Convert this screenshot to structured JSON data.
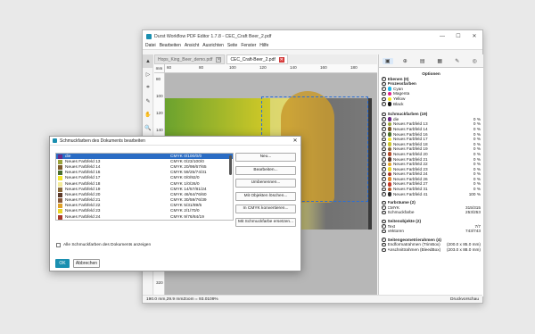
{
  "window": {
    "title": "Durst Workflow PDF Editor 1.7.8 - CEC_Craft Beer_2.pdf",
    "controls": [
      "—",
      "☐",
      "✕"
    ]
  },
  "menu": [
    "Datei",
    "Bearbeiten",
    "Ansicht",
    "Ausrichten",
    "Seite",
    "Fenster",
    "Hilfe"
  ],
  "left_tools": [
    "▲",
    "▷",
    "⌗",
    "✎",
    "✋",
    "🔍"
  ],
  "tabs": [
    {
      "label": "Hops_King_Beer_demo.pdf",
      "close": "✕"
    },
    {
      "label": "CEC_Craft-Beer_2.pdf",
      "close": "✕"
    }
  ],
  "ruler": {
    "unit": "mm",
    "h_ticks": [
      "60",
      "80",
      "100",
      "120",
      "140",
      "160",
      "180"
    ],
    "v_ticks": [
      "80",
      "100",
      "120",
      "140",
      "160",
      "180",
      "200",
      "220",
      "240",
      "260",
      "280",
      "300",
      "320"
    ]
  },
  "status": {
    "coords": "190.0 mm,29.9 mmZoom = 93.0109%",
    "right": "Druckvorschau"
  },
  "panel": {
    "icons": [
      "▣",
      "⊕",
      "▤",
      "▦",
      "✎",
      "◎"
    ],
    "optionen": "Optionen",
    "ebenen": "Ebenen (0)",
    "prozessfarben": "Prozessfarben",
    "process_colors": [
      {
        "name": "Cyan",
        "color": "#1fb6e8"
      },
      {
        "name": "Magenta",
        "color": "#e0218a"
      },
      {
        "name": "Yellow",
        "color": "#f3e61c"
      },
      {
        "name": "Black",
        "color": "#111111"
      }
    ],
    "schmuck_head": "Schmuckfarben (19)",
    "spot_colors": [
      {
        "name": "die",
        "val": "0 %",
        "color": "#6c2a86"
      },
      {
        "name": "Neues Farbfeld 13",
        "val": "0 %",
        "color": "#9aa33a"
      },
      {
        "name": "Neues Farbfeld 14",
        "val": "0 %",
        "color": "#7d5a2a"
      },
      {
        "name": "Neues Farbfeld 16",
        "val": "0 %",
        "color": "#4a6e2d"
      },
      {
        "name": "Neues Farbfeld 17",
        "val": "0 %",
        "color": "#f2e52a"
      },
      {
        "name": "Neues Farbfeld 18",
        "val": "0 %",
        "color": "#c8c22e"
      },
      {
        "name": "Neues Farbfeld 19",
        "val": "0 %",
        "color": "#8a6a3a"
      },
      {
        "name": "Neues Farbfeld 20",
        "val": "0 %",
        "color": "#b24a2a"
      },
      {
        "name": "Neues Farbfeld 21",
        "val": "0 %",
        "color": "#5c3a2a"
      },
      {
        "name": "Neues Farbfeld 22",
        "val": "0 %",
        "color": "#e0a12a"
      },
      {
        "name": "Neues Farbfeld 23",
        "val": "0 %",
        "color": "#e9d52a"
      },
      {
        "name": "Neues Farbfeld 24",
        "val": "0 %",
        "color": "#a8382a"
      },
      {
        "name": "Neues Farbfeld 26",
        "val": "0 %",
        "color": "#e08a2a"
      },
      {
        "name": "Neues Farbfeld 27",
        "val": "0 %",
        "color": "#c43a2a"
      },
      {
        "name": "Neues Farbfeld 31",
        "val": "0 %",
        "color": "#b85a2a"
      },
      {
        "name": "Neues Farbfeld 41",
        "val": "100 %",
        "color": "#2b2b2b"
      }
    ],
    "farbraeume_head": "Farbräume (2)",
    "farbraeume": [
      {
        "name": "CMYK",
        "val": "315/315"
      },
      {
        "name": "Schmuckfarbe",
        "val": "253/253"
      }
    ],
    "seitenobj_head": "Seitenobjekte (2)",
    "seitenobj": [
      {
        "name": "Text",
        "val": "7/7"
      },
      {
        "name": "Vektoren",
        "val": "743/743"
      }
    ],
    "geom_head": "Seitengeometrierahmen (4)",
    "geom": [
      {
        "name": "Endformatrahmen (TrimBox)",
        "val": "(200.0 x 85.0 mm)"
      },
      {
        "name": "Anschnittrahmen (BleedBox)",
        "val": "(203.0 x 88.0 mm)"
      }
    ]
  },
  "dialog": {
    "title": "Schmuckfarben des Dokuments bearbeiten",
    "rows": [
      {
        "name": "die",
        "cmyk": "CMYK  0/100/0/0",
        "color": "#6c2a86"
      },
      {
        "name": "Neues Farbfeld 13",
        "cmyk": "CMYK  0/23/100/0",
        "color": "#9aa33a"
      },
      {
        "name": "Neues Farbfeld 14",
        "cmyk": "CMYK  20/98/67/65",
        "color": "#7d5a2a"
      },
      {
        "name": "Neues Farbfeld 16",
        "cmyk": "CMYK  59/25/74/31",
        "color": "#4a6e2d"
      },
      {
        "name": "Neues Farbfeld 17",
        "cmyk": "CMYK  0/0/92/0",
        "color": "#f2e52a"
      },
      {
        "name": "Neues Farbfeld 18",
        "cmyk": "CMYK  1/0/26/0",
        "color": "#f3ea9a"
      },
      {
        "name": "Neues Farbfeld 19",
        "cmyk": "CMYK  14/57/81/24",
        "color": "#8a6a3a"
      },
      {
        "name": "Neues Farbfeld 20",
        "cmyk": "CMYK  46/64/76/60",
        "color": "#5c3a2a"
      },
      {
        "name": "Neues Farbfeld 21",
        "cmyk": "CMYK  30/59/76/39",
        "color": "#8a5a3a"
      },
      {
        "name": "Neues Farbfeld 22",
        "cmyk": "CMYK  5/31/89/5",
        "color": "#e0a12a"
      },
      {
        "name": "Neues Farbfeld 23",
        "cmyk": "CMYK  2/1/70/0",
        "color": "#e9d52a"
      },
      {
        "name": "Neues Farbfeld 24",
        "cmyk": "CMYK  9/76/84/19",
        "color": "#a8382a"
      }
    ],
    "buttons": [
      "Neu...",
      "Bearbeiten...",
      "Umbenennen...",
      "Mit Objekten löschen...",
      "In CMYK konvertieren...",
      "Mit Schmuckfarbe ersetzen..."
    ],
    "show_all": "Alle Schmuckfarben des Dokuments anzeigen",
    "ok": "OK",
    "cancel": "Abbrechen",
    "close": "✕"
  }
}
